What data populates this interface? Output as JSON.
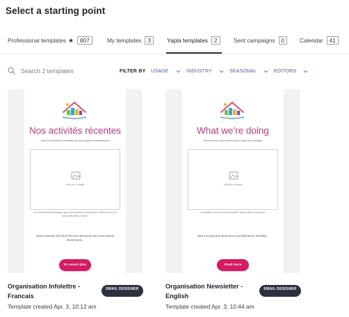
{
  "page_title": "Select a starting point",
  "tabs": [
    {
      "label": "Professional templates",
      "count": "807",
      "icon": "star-icon"
    },
    {
      "label": "My templates",
      "count": "3"
    },
    {
      "label": "Yapla templates",
      "count": "2",
      "active": true
    },
    {
      "label": "Sent campaigns",
      "count": "0"
    },
    {
      "label": "Calendar",
      "count": "41"
    }
  ],
  "search": {
    "placeholder": "Search 2 templates",
    "icon": "search-icon"
  },
  "filters": {
    "label": "FILTER BY",
    "options": [
      "USAGE",
      "INDUSTRY",
      "SEASONAL",
      "EDITORS"
    ],
    "accent_color": "#3b5bdb"
  },
  "templates": [
    {
      "preview": {
        "title": "Nos activités récentes",
        "subtitle": "Voici les dernières nouvelles de nos projets et événements",
        "image_placeholder": "Add your image",
        "caption": "Un événement fantastique que nous avons eu récemment ! Merci à tous de nous être joints à nous !",
        "body": "Nous sommes très fiers de vous annoncer que nous avons récemment...",
        "button": "En savoir plus"
      },
      "name": "Organisation Infolettre - Francais",
      "badge": "EMAIL DESIGNER",
      "meta": "Template created Apr. 3, 10:12 am"
    },
    {
      "preview": {
        "title": "What we're doing",
        "subtitle": "Here are the most recent news about our activities",
        "image_placeholder": "Add your image",
        "caption": "A fantastic event we had recently! Thanks all for joining us!",
        "body": "We're so proud to announce you that we've recently...",
        "button": "Read more"
      },
      "name": "Organisation Newsletter - English",
      "badge": "EMAIL DESIGNER",
      "meta": "Template created Apr. 3, 10:44 am"
    }
  ],
  "colors": {
    "brand_pink": "#d81b60",
    "badge_dark": "#2d3140"
  }
}
